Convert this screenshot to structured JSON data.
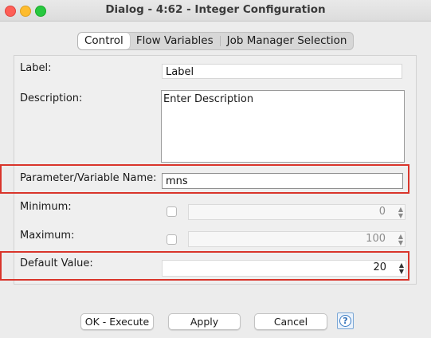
{
  "window": {
    "title": "Dialog - 4:62 - Integer Configuration"
  },
  "tabs": [
    {
      "label": "Control",
      "active": true
    },
    {
      "label": "Flow Variables",
      "active": false
    },
    {
      "label": "Job Manager Selection",
      "active": false
    }
  ],
  "form": {
    "label": {
      "label": "Label:",
      "value": "Label"
    },
    "description": {
      "label": "Description:",
      "value": "Enter Description"
    },
    "parameter": {
      "label": "Parameter/Variable Name:",
      "value": "mns"
    },
    "minimum": {
      "label": "Minimum:",
      "value": "0",
      "checked": false
    },
    "maximum": {
      "label": "Maximum:",
      "value": "100",
      "checked": false
    },
    "default": {
      "label": "Default Value:",
      "value": "20"
    }
  },
  "buttons": {
    "ok": "OK - Execute",
    "apply": "Apply",
    "cancel": "Cancel",
    "help": "?"
  },
  "colors": {
    "highlight": "#d9352b",
    "close": "#fe5f57",
    "minimize": "#febc2e",
    "zoom": "#28c840"
  }
}
